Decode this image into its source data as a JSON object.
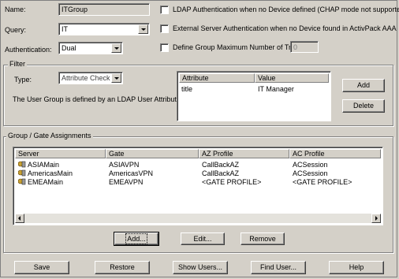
{
  "name": {
    "label": "Name:",
    "value": "ITGroup"
  },
  "query": {
    "label": "Query:",
    "value": "IT"
  },
  "authentication": {
    "label": "Authentication:",
    "value": "Dual"
  },
  "options": {
    "ldap_auth": "LDAP Authentication when no Device defined (CHAP mode not supported)",
    "external_auth": "External Server Authentication when no Device found in ActivPack AAA Server",
    "max_tries": "Define Group Maximum Number of Tries:",
    "max_tries_value": "0"
  },
  "filter": {
    "title": "Filter",
    "type_label": "Type:",
    "type_value": "Attribute Check",
    "description": "The User Group is defined by an LDAP User Attribute.",
    "columns": [
      "Attribute",
      "Value"
    ],
    "rows": [
      {
        "attribute": "title",
        "value": "IT Manager"
      }
    ],
    "add_label": "Add",
    "delete_label": "Delete"
  },
  "assignments": {
    "title": "Group / Gate Assignments",
    "columns": [
      "Server",
      "Gate",
      "AZ Profile",
      "AC Profile"
    ],
    "rows": [
      {
        "server": "ASIAMain",
        "gate": "ASIAVPN",
        "az": "CallBackAZ",
        "ac": "ACSession"
      },
      {
        "server": "AmericasMain",
        "gate": "AmericasVPN",
        "az": "CallBackAZ",
        "ac": "ACSession"
      },
      {
        "server": "EMEAMain",
        "gate": "EMEAVPN",
        "az": "<GATE PROFILE>",
        "ac": "<GATE PROFILE>"
      }
    ],
    "add_label": "Add...",
    "edit_label": "Edit...",
    "remove_label": "Remove"
  },
  "bottom": {
    "save": "Save",
    "restore": "Restore",
    "show_users": "Show Users...",
    "find_user": "Find User...",
    "help": "Help"
  }
}
